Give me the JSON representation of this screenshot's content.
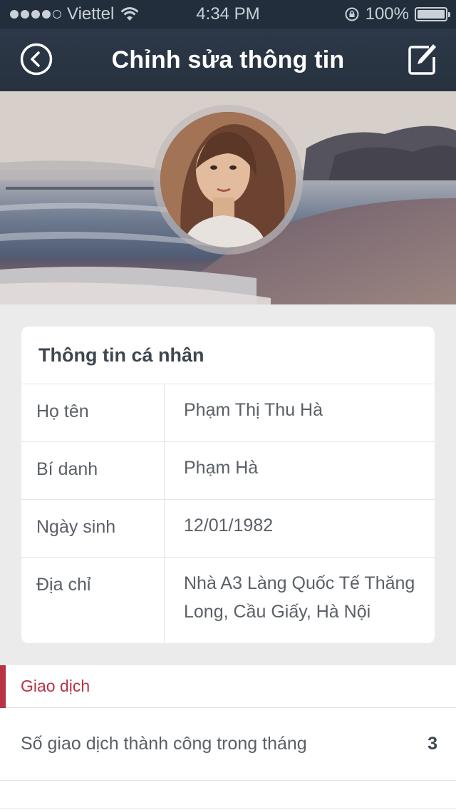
{
  "status_bar": {
    "carrier": "Viettel",
    "time": "4:34 PM",
    "battery": "100%",
    "signal_bars_filled": 4,
    "signal_bars_total": 5
  },
  "nav": {
    "title": "Chỉnh sửa thông tin",
    "back_icon": "back-circle-icon",
    "edit_icon": "edit-icon"
  },
  "profile": {
    "cover": "beach-cover-photo",
    "avatar": "profile-photo"
  },
  "personal_info": {
    "title": "Thông tin cá nhân",
    "rows": [
      {
        "label": "Họ tên",
        "value": "Phạm Thị Thu Hà"
      },
      {
        "label": "Bí danh",
        "value": "Phạm Hà"
      },
      {
        "label": "Ngày sinh",
        "value": "12/01/1982"
      },
      {
        "label": "Địa chỉ",
        "value": "Nhà A3 Làng Quốc Tế Thăng Long, Cầu Giấy, Hà Nội"
      }
    ]
  },
  "transactions": {
    "header": "Giao dịch",
    "stat_label": "Số giao dịch thành công trong tháng",
    "stat_value": "3"
  },
  "colors": {
    "nav_bg": "#27323f",
    "accent": "#b83244",
    "text": "#5b6068"
  }
}
